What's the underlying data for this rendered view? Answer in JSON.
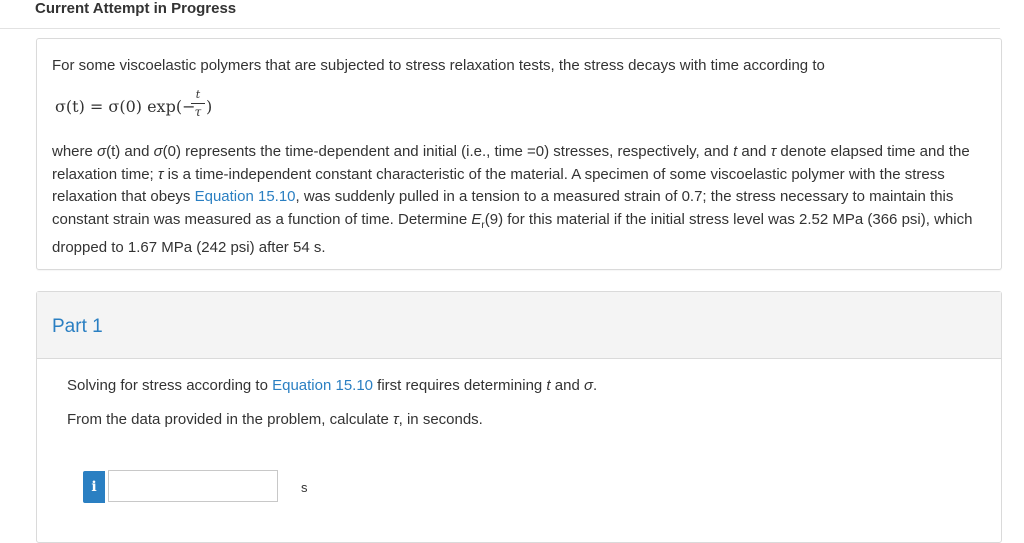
{
  "header": {
    "title": "Current Attempt in Progress"
  },
  "problem": {
    "intro": "For some viscoelastic polymers that are subjected to stress relaxation tests, the stress decays with time according to",
    "formula": {
      "lhs": "σ(t) = σ(0) exp(−",
      "numerator": "t",
      "denominator": "τ",
      "close": ")"
    },
    "desc_parts": {
      "p1": "where ",
      "sigma_t": "σ",
      "p2": "(t) and ",
      "sigma_0": "σ",
      "p3": "(0) represents the time-dependent and initial (i.e., time =0) stresses, respectively, and ",
      "t_var": "t",
      "p4": " and ",
      "tau_var": "τ",
      "p5": " denote elapsed time and the relaxation time; ",
      "tau_var2": "τ",
      "p6": " is a time-independent constant characteristic of the material. A specimen of some viscoelastic polymer with the stress relaxation that obeys ",
      "equation_link": "Equation 15.10",
      "p7": ", was suddenly pulled in a tension to a measured strain of 0.7; the stress necessary to maintain this constant strain was measured as a function of time. Determine ",
      "E_var": "E",
      "E_sub": "r",
      "p8": "(9) for this material if the initial stress level was 2.52 MPa (366 psi), which dropped to 1.67 MPa (242 psi) after 54 s."
    }
  },
  "part": {
    "title": "Part 1",
    "line1_a": "Solving for stress according to ",
    "line1_link": "Equation 15.10",
    "line1_b": " first requires determining ",
    "line1_t": "t",
    "line1_c": " and ",
    "line1_sigma": "σ",
    "line1_d": ".",
    "line2_a": "From the data provided in the problem, calculate ",
    "line2_tau": "τ",
    "line2_b": ", in seconds.",
    "info_label": "i",
    "answer_value": "",
    "unit": "s"
  }
}
